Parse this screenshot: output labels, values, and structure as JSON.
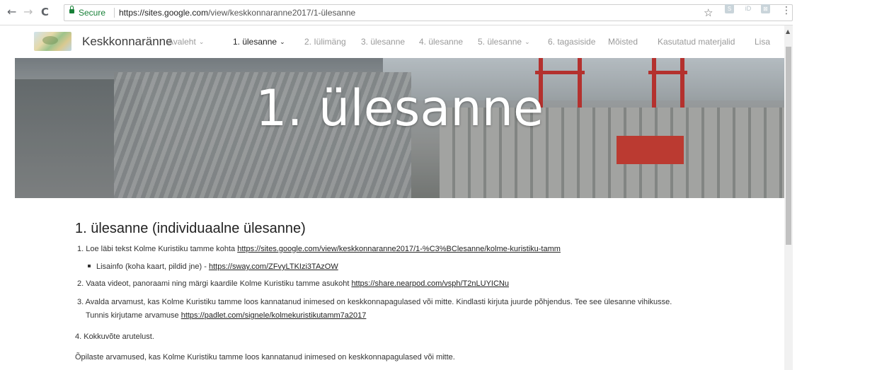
{
  "browser": {
    "back_glyph": "←",
    "forward_glyph": "→",
    "reload_glyph": "C",
    "secure_label": "Secure",
    "url_host": "https://sites.google.com",
    "url_path": "/view/keskkonnaranne2017/1-ülesanne",
    "star_icon": "☆",
    "menu_icon": "⋮",
    "extensions": [
      "S",
      "iD",
      "⊠"
    ]
  },
  "site": {
    "title": "Keskkonnaränne",
    "nav": [
      {
        "label": "Avaleht",
        "dropdown": true,
        "active": false
      },
      {
        "label": "1. ülesanne",
        "dropdown": true,
        "active": true
      },
      {
        "label": "2. Iülimäng",
        "dropdown": false,
        "active": false
      },
      {
        "label": "3. ülesanne",
        "dropdown": false,
        "active": false
      },
      {
        "label": "4. ülesanne",
        "dropdown": false,
        "active": false
      },
      {
        "label": "5. ülesanne",
        "dropdown": true,
        "active": false
      },
      {
        "label": "6. tagasiside",
        "dropdown": false,
        "active": false
      },
      {
        "label": "Mõisted",
        "dropdown": false,
        "active": false
      },
      {
        "label": "Kasutatud materjalid",
        "dropdown": false,
        "active": false
      },
      {
        "label": "Lisa",
        "dropdown": false,
        "active": false
      }
    ],
    "chevron": "❯"
  },
  "hero": {
    "title": "1. ülesanne"
  },
  "content": {
    "heading": "1. ülesanne (individuaalne ülesanne)",
    "item1_text": "1. Loe läbi tekst Kolme Kuristiku tamme kohta ",
    "item1_link": "https://sites.google.com/view/keskkonnaranne2017/1-%C3%BClesanne/kolme-kuristiku-tamm",
    "subitem_text": "Lisainfo (koha kaart, pildid jne) - ",
    "subitem_link": "https://sway.com/ZFvyLTKIzi3TAzOW",
    "item2_text": "2. Vaata videot, panoraami ning märgi kaardile Kolme Kuristiku tamme asukoht ",
    "item2_link": "https://share.nearpod.com/vsph/T2nLUYICNu",
    "item3_text": "3. Avalda arvamust, kas Kolme Kuristiku tamme loos kannatanud inimesed on keskkonnapagulased või mitte. Kindlasti kirjuta juurde põhjendus. Tee see ülesanne vihikusse.",
    "item3b_text": "Tunnis kirjutame arvamuse ",
    "item3b_link": "https://padlet.com/signele/kolmekuristikutamm7a2017",
    "item4_text": "4. Kokkuvõte arutelust.",
    "summary_text": "Õpilaste arvamused, kas Kolme Kuristiku tamme loos kannatanud inimesed on keskkonnapagulased või mitte."
  },
  "colors": {
    "secure_green": "#188038",
    "nav_inactive": "#9a9a9a",
    "nav_active": "#222222"
  }
}
